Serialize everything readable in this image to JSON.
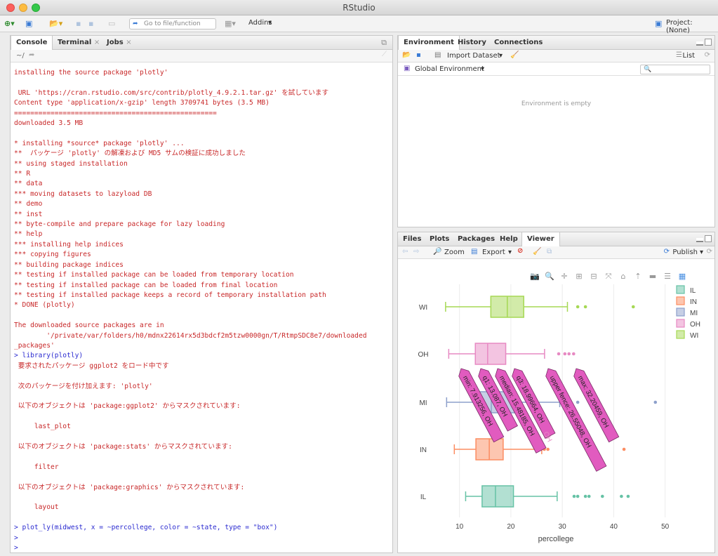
{
  "window": {
    "title": "RStudio"
  },
  "main_toolbar": {
    "goto_placeholder": "Go to file/function",
    "addins_label": "Addins",
    "project_label": "Project: (None)"
  },
  "console_pane": {
    "tabs": [
      "Console",
      "Terminal",
      "Jobs"
    ],
    "path": "~/",
    "lines": [
      {
        "t": "installing the source package 'plotly'",
        "c": "red"
      },
      {
        "t": "",
        "c": "gap"
      },
      {
        "t": " URL 'https://cran.rstudio.com/src/contrib/plotly_4.9.2.1.tar.gz' を試しています",
        "c": "red"
      },
      {
        "t": "Content type 'application/x-gzip' length 3709741 bytes (3.5 MB)",
        "c": "red"
      },
      {
        "t": "==================================================",
        "c": "red"
      },
      {
        "t": "downloaded 3.5 MB",
        "c": "red"
      },
      {
        "t": "",
        "c": "gap"
      },
      {
        "t": "* installing *source* package 'plotly' ...",
        "c": "red"
      },
      {
        "t": "**  パッケージ 'plotly' の解凍および MD5 サムの検証に成功しました",
        "c": "red"
      },
      {
        "t": "** using staged installation",
        "c": "red"
      },
      {
        "t": "** R",
        "c": "red"
      },
      {
        "t": "** data",
        "c": "red"
      },
      {
        "t": "*** moving datasets to lazyload DB",
        "c": "red"
      },
      {
        "t": "** demo",
        "c": "red"
      },
      {
        "t": "** inst",
        "c": "red"
      },
      {
        "t": "** byte-compile and prepare package for lazy loading",
        "c": "red"
      },
      {
        "t": "** help",
        "c": "red"
      },
      {
        "t": "*** installing help indices",
        "c": "red"
      },
      {
        "t": "*** copying figures",
        "c": "red"
      },
      {
        "t": "** building package indices",
        "c": "red"
      },
      {
        "t": "** testing if installed package can be loaded from temporary location",
        "c": "red"
      },
      {
        "t": "** testing if installed package can be loaded from final location",
        "c": "red"
      },
      {
        "t": "** testing if installed package keeps a record of temporary installation path",
        "c": "red"
      },
      {
        "t": "* DONE (plotly)",
        "c": "red"
      },
      {
        "t": "",
        "c": "gap"
      },
      {
        "t": "The downloaded source packages are in",
        "c": "red"
      },
      {
        "t": "        '/private/var/folders/h0/mdnx22614rx5d3bdcf2m5tzw0000gn/T/RtmpSDC8e7/downloaded",
        "c": "red"
      },
      {
        "t": "_packages'",
        "c": "red"
      },
      {
        "t": "> library(plotly)",
        "c": "blue"
      },
      {
        "t": " 要求されたパッケージ ggplot2 をロード中です",
        "c": "red"
      },
      {
        "t": "",
        "c": "gap"
      },
      {
        "t": " 次のパッケージを付け加えます: 'plotly'",
        "c": "red"
      },
      {
        "t": "",
        "c": "gap"
      },
      {
        "t": " 以下のオブジェクトは 'package:ggplot2' からマスクされています:",
        "c": "red"
      },
      {
        "t": "",
        "c": "gap"
      },
      {
        "t": "     last_plot",
        "c": "red"
      },
      {
        "t": "",
        "c": "gap"
      },
      {
        "t": " 以下のオブジェクトは 'package:stats' からマスクされています:",
        "c": "red"
      },
      {
        "t": "",
        "c": "gap"
      },
      {
        "t": "     filter",
        "c": "red"
      },
      {
        "t": "",
        "c": "gap"
      },
      {
        "t": " 以下のオブジェクトは 'package:graphics' からマスクされています:",
        "c": "red"
      },
      {
        "t": "",
        "c": "gap"
      },
      {
        "t": "     layout",
        "c": "red"
      },
      {
        "t": "",
        "c": "gap"
      },
      {
        "t": "> plot_ly(midwest, x = ~percollege, color = ~state, type = \"box\")",
        "c": "blue"
      },
      {
        "t": ">",
        "c": "blue"
      },
      {
        "t": ">",
        "c": "blue"
      }
    ]
  },
  "env_pane": {
    "tabs": [
      "Environment",
      "History",
      "Connections"
    ],
    "import_label": "Import Dataset",
    "list_label": "List",
    "scope_label": "Global Environment",
    "empty_text": "Environment is empty"
  },
  "viewer_pane": {
    "tabs": [
      "Files",
      "Plots",
      "Packages",
      "Help",
      "Viewer"
    ],
    "zoom_label": "Zoom",
    "export_label": "Export",
    "publish_label": "Publish"
  },
  "colors": {
    "IL": "#66c2a5",
    "IN": "#fc8d62",
    "MI": "#8da0cb",
    "OH": "#e78ac3",
    "WI": "#a6d854"
  },
  "chart_data": {
    "type": "box",
    "orientation": "horizontal",
    "xlabel": "percollege",
    "xticks": [
      10,
      20,
      30,
      40,
      50
    ],
    "xlim": [
      6.5,
      51
    ],
    "categories": [
      "IL",
      "IN",
      "MI",
      "OH",
      "WI"
    ],
    "legend": [
      "IL",
      "IN",
      "MI",
      "OH",
      "WI"
    ],
    "legend_position": "top-right",
    "series": [
      {
        "name": "IL",
        "min": 11.2,
        "q1": 14.4,
        "median": 17.0,
        "q3": 20.5,
        "max": 29.0,
        "outliers": [
          32.3,
          33.0,
          34.5,
          35.2,
          37.8,
          41.5,
          42.8
        ]
      },
      {
        "name": "IN",
        "min": 9.0,
        "q1": 13.2,
        "median": 15.8,
        "q3": 18.5,
        "max": 26.0,
        "outliers": [
          26.5,
          27.2,
          42.0
        ]
      },
      {
        "name": "MI",
        "min": 7.5,
        "q1": 13.8,
        "median": 16.2,
        "q3": 21.0,
        "max": 29.5,
        "outliers": [
          33.0,
          48.1
        ]
      },
      {
        "name": "OH",
        "min": 7.913256,
        "q1": 13.087,
        "median": 15.48185,
        "q3": 18.99664,
        "max": 26.55048,
        "outliers": [
          29.3,
          30.5,
          31.3,
          32.20459
        ]
      },
      {
        "name": "WI",
        "min": 7.3,
        "q1": 16.1,
        "median": 19.3,
        "q3": 22.5,
        "max": 31.0,
        "outliers": [
          33.0,
          34.5,
          43.8
        ]
      }
    ],
    "hover_labels": [
      "min: 7.913256, OH",
      "q1: 13.087, OH",
      "median: 15.48185, OH",
      "q3: 18.99664, OH",
      "upper fence: 26.55048, OH",
      "max: 32.20459, OH"
    ],
    "hover_x_label": "OH"
  }
}
